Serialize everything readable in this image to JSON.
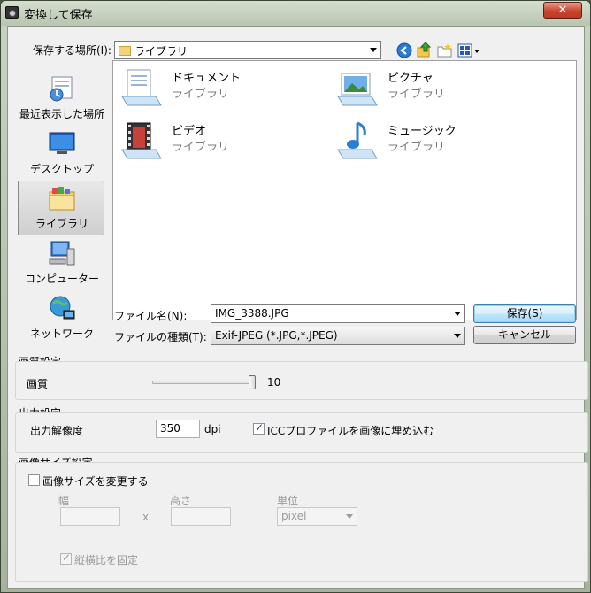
{
  "window": {
    "title": "変換して保存",
    "close_label": "✕"
  },
  "location": {
    "label": "保存する場所(I):",
    "value": "ライブラリ"
  },
  "places": [
    {
      "label": "最近表示した場所",
      "icon": "recent-places-icon"
    },
    {
      "label": "デスクトップ",
      "icon": "desktop-icon"
    },
    {
      "label": "ライブラリ",
      "icon": "libraries-icon"
    },
    {
      "label": "コンピューター",
      "icon": "computer-icon"
    },
    {
      "label": "ネットワーク",
      "icon": "network-icon"
    }
  ],
  "files": [
    {
      "name": "ドキュメント",
      "sub": "ライブラリ",
      "icon": "documents-library-icon"
    },
    {
      "name": "ピクチャ",
      "sub": "ライブラリ",
      "icon": "pictures-library-icon"
    },
    {
      "name": "ビデオ",
      "sub": "ライブラリ",
      "icon": "videos-library-icon"
    },
    {
      "name": "ミュージック",
      "sub": "ライブラリ",
      "icon": "music-library-icon"
    }
  ],
  "filename": {
    "label": "ファイル名(N):",
    "value": "IMG_3388.JPG"
  },
  "filetype": {
    "label": "ファイルの種類(T):",
    "value": "Exif-JPEG (*.JPG,*.JPEG)"
  },
  "buttons": {
    "save": "保存(S)",
    "cancel": "キャンセル"
  },
  "quality": {
    "section": "画質設定",
    "label": "画質",
    "value": "10",
    "level": 1.0
  },
  "output": {
    "section": "出力設定",
    "label": "出力解像度",
    "value": "350",
    "unit": "dpi",
    "icc_label": "ICCプロファイルを画像に埋め込む",
    "icc_checked": true
  },
  "resize": {
    "section": "画像サイズ設定",
    "checkbox_label": "画像サイズを変更する",
    "width_label": "幅",
    "times": "x",
    "height_label": "高さ",
    "unit_label": "単位",
    "unit_value": "pixel",
    "aspect_label": "縦横比を固定"
  }
}
